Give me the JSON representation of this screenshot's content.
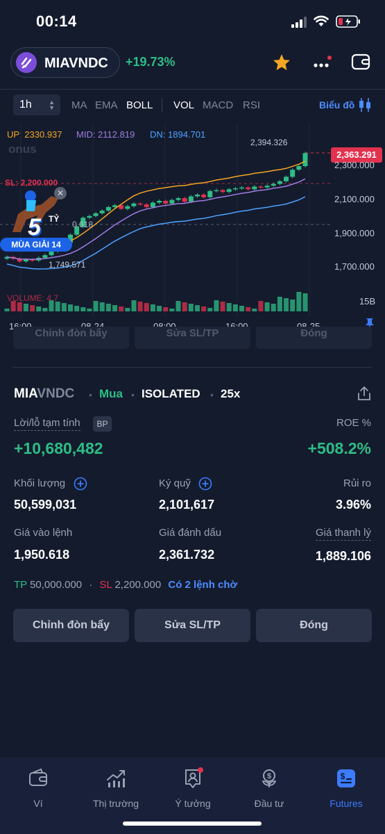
{
  "status_bar": {
    "time": "00:14"
  },
  "header": {
    "pair": "MIAVNDC",
    "change_pct": "+19.73%",
    "colors": {
      "up": "#2ebd85",
      "down": "#e2324e",
      "accent": "#3d7bff",
      "star": "#f5a623"
    }
  },
  "chart_toolbar": {
    "timeframe": "1h",
    "indicators": [
      "MA",
      "EMA",
      "BOLL",
      "VOL",
      "MACD",
      "RSI"
    ],
    "active_indicators": [
      "BOLL",
      "VOL"
    ],
    "chart_button": "Biểu đồ"
  },
  "chart": {
    "boll": {
      "up": "UP: 2330.937",
      "mid": "MID: 2112.819",
      "dn": "DN: 1894.701"
    },
    "watermark": "onus",
    "current_price": "2,363.291",
    "high_label": "2,394.326",
    "low_label": "1,749.571",
    "sl_line_label": "SL: 2,200.000",
    "entry_line_label_partial": "0.618",
    "volume_label": "VOLUME: 4.7",
    "volume_axis": "15B",
    "y_axis": [
      "2,300.000",
      "2,100.000",
      "1,900.000",
      "1,700.000"
    ],
    "x_axis": [
      "16:00",
      "08-24",
      "08:00",
      "16:00",
      "08-25"
    ],
    "promo": {
      "amount": "5",
      "unit": "TỶ",
      "banner": "MÙA GIẢI 14"
    }
  },
  "chart_data": {
    "type": "candlestick",
    "boll_up": 2330.937,
    "boll_mid": 2112.819,
    "boll_dn": 1894.701,
    "last": 2363.291,
    "high": 2394.326,
    "low": 1749.571,
    "stop_loss": 2200.0,
    "ylim": [
      1650,
      2450
    ]
  },
  "ghost_buttons": [
    "Chỉnh đòn bẩy",
    "Sửa SL/TP",
    "Đóng"
  ],
  "position": {
    "symbol_base": "MIA",
    "symbol_quote": "VNDC",
    "side": "Mua",
    "margin_mode": "ISOLATED",
    "leverage": "25x",
    "pnl_label": "Lời/lỗ tạm tính",
    "bp_badge": "BP",
    "pnl_value": "+10,680,482",
    "roe_label": "ROE %",
    "roe_value": "+508.2%",
    "volume_label": "Khối lượng",
    "volume_value": "50,599,031",
    "margin_label": "Ký quỹ",
    "margin_value": "2,101,617",
    "risk_label": "Rủi ro",
    "risk_value": "3.96%",
    "entry_label": "Giá vào lệnh",
    "entry_value": "1,950.618",
    "mark_label": "Giá đánh dấu",
    "mark_value": "2,361.732",
    "liq_label": "Giá thanh lý",
    "liq_value": "1,889.106",
    "tp_key": "TP",
    "tp_value": "50,000.000",
    "sl_key": "SL",
    "sl_value": "2,200.000",
    "pending_orders": "Có 2 lệnh chờ"
  },
  "actions": {
    "leverage": "Chỉnh đòn bẩy",
    "edit_tpsl": "Sửa SL/TP",
    "close": "Đóng"
  },
  "bottom_nav": [
    {
      "label": "Ví",
      "icon": "wallet-icon"
    },
    {
      "label": "Thị trường",
      "icon": "market-chart-icon"
    },
    {
      "label": "Ý tưởng",
      "icon": "ideas-user-icon"
    },
    {
      "label": "Đầu tư",
      "icon": "invest-plant-icon"
    },
    {
      "label": "Futures",
      "icon": "futures-icon",
      "active": true
    }
  ]
}
